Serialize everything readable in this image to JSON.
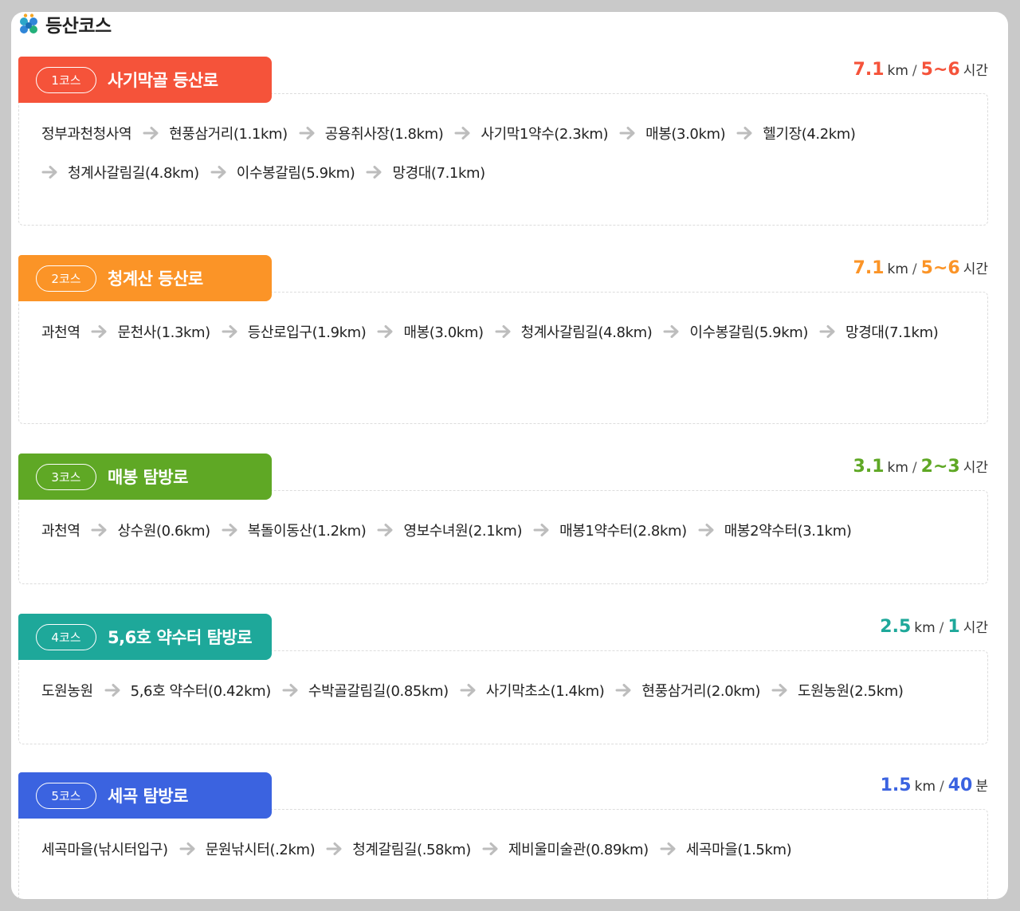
{
  "header": {
    "title": "등산코스"
  },
  "courses": [
    {
      "badge": "1코스",
      "name": "사기막골 등산로",
      "color": "#f5533a",
      "distance": "7.1",
      "distance_unit": "km",
      "duration": "5~6",
      "duration_unit": "시간",
      "stops": [
        "정부과천청사역",
        "현풍삼거리(1.1km)",
        "공용취사장(1.8km)",
        "사기막1약수(2.3km)",
        "매봉(3.0km)",
        "헬기장(4.2km)",
        "청계사갈림길(4.8km)",
        "이수봉갈림(5.9km)",
        "망경대(7.1km)"
      ]
    },
    {
      "badge": "2코스",
      "name": "청계산 등산로",
      "color": "#fb9427",
      "distance": "7.1",
      "distance_unit": "km",
      "duration": "5~6",
      "duration_unit": "시간",
      "stops": [
        "과천역",
        "문천사(1.3km)",
        "등산로입구(1.9km)",
        "매봉(3.0km)",
        "청계사갈림길(4.8km)",
        "이수봉갈림(5.9km)",
        "망경대(7.1km)"
      ]
    },
    {
      "badge": "3코스",
      "name": "매봉 탐방로",
      "color": "#5fa825",
      "distance": "3.1",
      "distance_unit": "km",
      "duration": "2~3",
      "duration_unit": "시간",
      "stops": [
        "과천역",
        "상수원(0.6km)",
        "복돌이동산(1.2km)",
        "영보수녀원(2.1km)",
        "매봉1약수터(2.8km)",
        "매봉2약수터(3.1km)"
      ]
    },
    {
      "badge": "4코스",
      "name": "5,6호 약수터 탐방로",
      "color": "#1ea89a",
      "distance": "2.5",
      "distance_unit": "km",
      "duration": "1",
      "duration_unit": "시간",
      "stops": [
        "도원농원",
        "5,6호 약수터(0.42km)",
        "수박골갈림길(0.85km)",
        "사기막초소(1.4km)",
        "현풍삼거리(2.0km)",
        "도원농원(2.5km)"
      ]
    },
    {
      "badge": "5코스",
      "name": "세곡 탐방로",
      "color": "#3b63e0",
      "distance": "1.5",
      "distance_unit": "km",
      "duration": "40",
      "duration_unit": "분",
      "stops": [
        "세곡마을(낚시터입구)",
        "문원낚시터(.2km)",
        "청계갈림길(.58km)",
        "제비울미술관(0.89km)",
        "세곡마을(1.5km)"
      ]
    }
  ]
}
